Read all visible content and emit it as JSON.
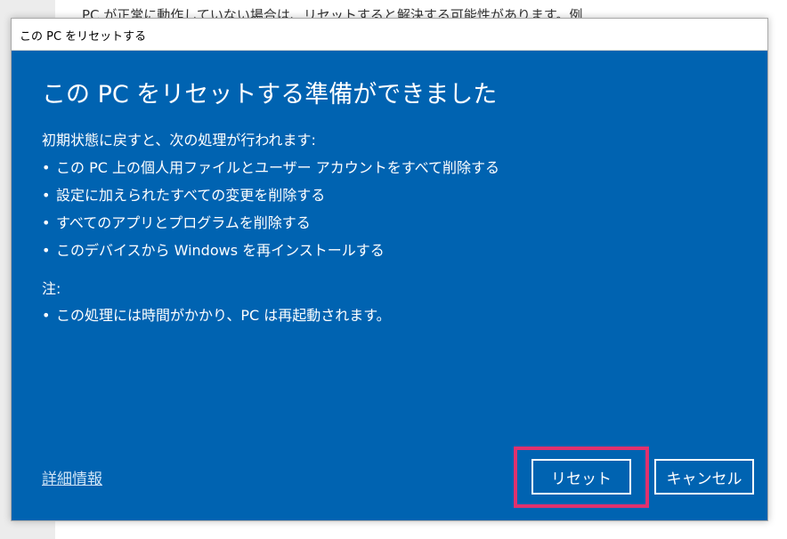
{
  "background": {
    "text": "PC が正常に動作していない場合は、リセットすると解決する可能性があります。例"
  },
  "dialog": {
    "title": "この PC をリセットする",
    "heading": "この PC をリセットする準備ができました",
    "intro": "初期状態に戻すと、次の処理が行われます:",
    "actions": [
      "この PC 上の個人用ファイルとユーザー アカウントをすべて削除する",
      "設定に加えられたすべての変更を削除する",
      "すべてのアプリとプログラムを削除する",
      "このデバイスから Windows を再インストールする"
    ],
    "note_label": "注:",
    "notes": [
      "この処理には時間がかかり、PC は再起動されます。"
    ],
    "more_info_link": "詳細情報",
    "reset_button": "リセット",
    "cancel_button": "キャンセル",
    "bullet": "•"
  },
  "colors": {
    "dialog_blue": "#0063b1",
    "highlight": "#e0316e"
  }
}
